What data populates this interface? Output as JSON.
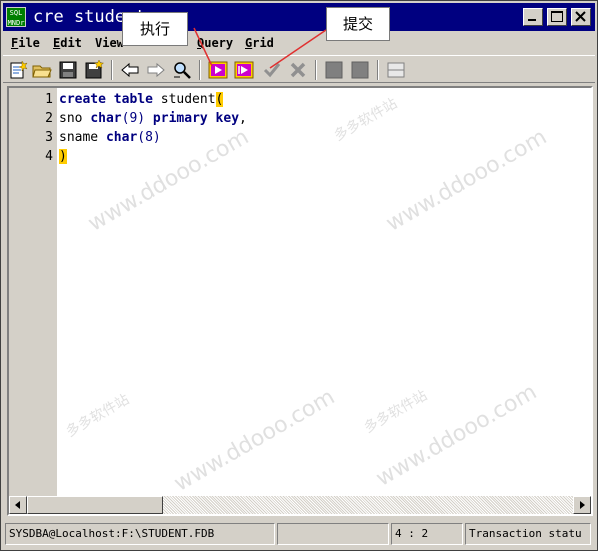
{
  "window": {
    "logo_text_top": "SQL",
    "logo_text_bottom": "MNDr",
    "title": "cre student"
  },
  "menu": [
    {
      "key": "F",
      "rest": "ile"
    },
    {
      "key": "E",
      "rest": "dit"
    },
    {
      "key": "",
      "rest": "View"
    },
    {
      "key": "Q",
      "rest": "uery"
    },
    {
      "key": "G",
      "rest": "rid"
    }
  ],
  "toolbar": {
    "icons": [
      "new-sql-icon",
      "open-folder-icon",
      "save-icon",
      "save-as-icon",
      "back-arrow-icon",
      "forward-arrow-icon",
      "find-icon",
      "execute-icon",
      "execute-step-icon",
      "commit-checkmark-icon",
      "rollback-x-icon",
      "grid-view-icon",
      "grid-view-alt-icon",
      "split-pane-icon"
    ],
    "accent_execute": "#cc00cc",
    "accent_yellow": "#ffcc00"
  },
  "editor": {
    "line_numbers": [
      "1",
      "2",
      "3",
      "4"
    ],
    "lines": {
      "l1_kw": "create table",
      "l1_plain": " student",
      "l1_paren": "(",
      "l2_plain": "sno ",
      "l2_kw1": "char",
      "l2_paren": "(9)",
      "l2_kw2": " primary key",
      "l2_end": ",",
      "l3_plain": "sname ",
      "l3_kw": "char",
      "l3_paren": "(8)",
      "l4_paren": ")"
    }
  },
  "status": {
    "connection": "SYSDBA@Localhost:F:\\STUDENT.FDB",
    "empty": "",
    "position": "4 : 2",
    "transaction": "Transaction statu"
  },
  "callouts": {
    "execute": "执行",
    "commit": "提交"
  },
  "watermarks": {
    "site": "www.ddooo.com",
    "cn": "多多软件站"
  }
}
